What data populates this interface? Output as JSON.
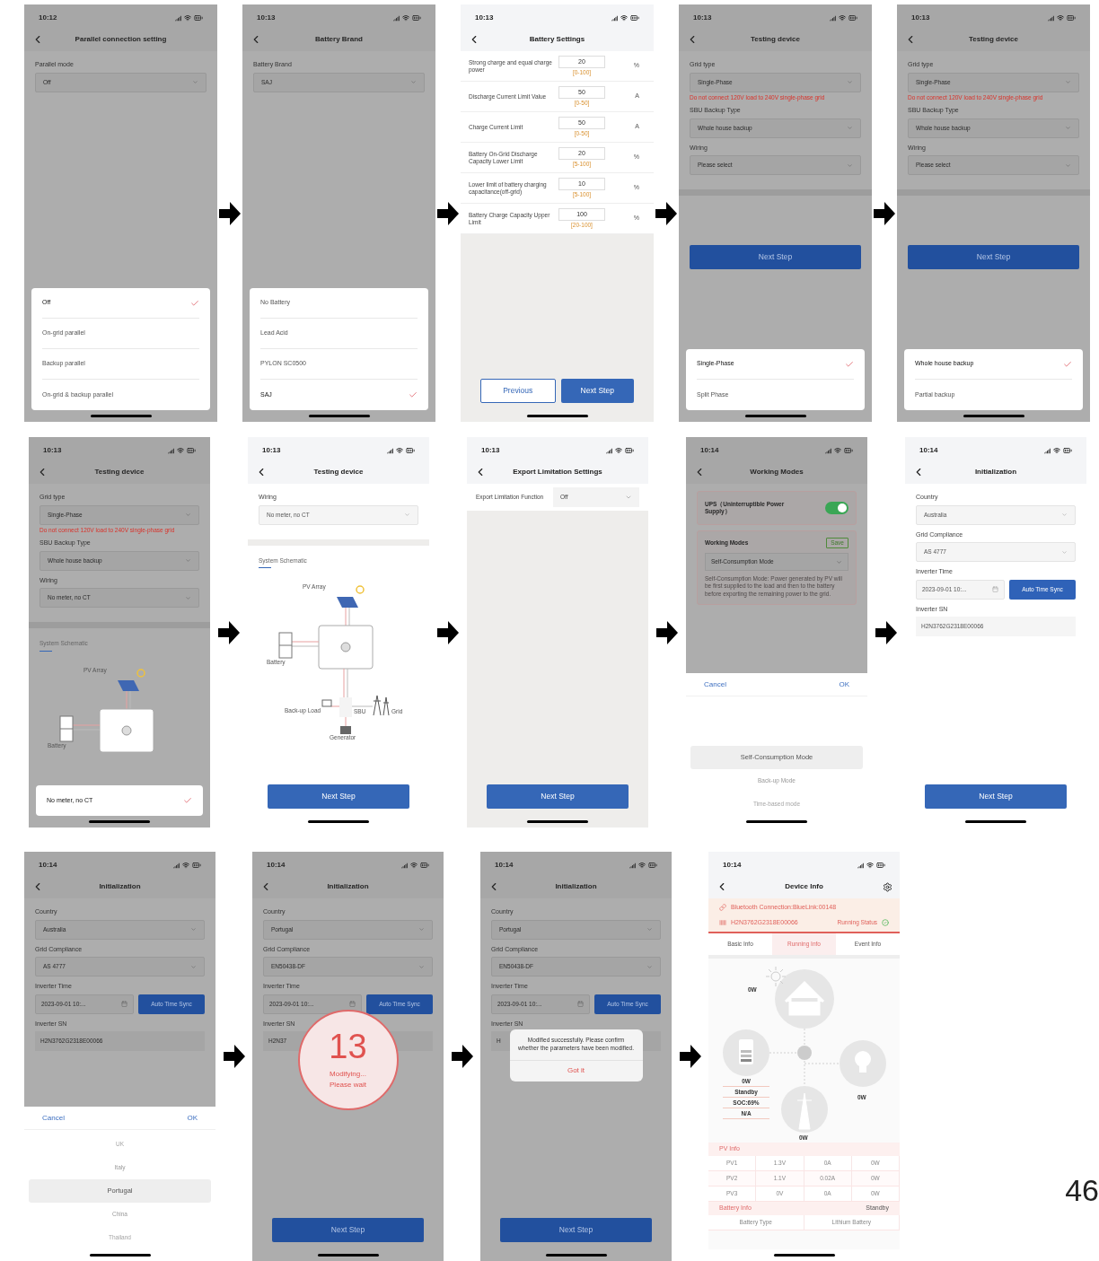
{
  "rows": [
    {
      "screens": [
        {
          "time": "10:12",
          "title": "Parallel connection setting",
          "dimmed": true,
          "body": [
            {
              "kind": "label",
              "text": "Parallel mode"
            },
            {
              "kind": "select",
              "value": "Off"
            }
          ],
          "sheet": {
            "kind": "options",
            "options": [
              {
                "label": "Off",
                "selected": true
              },
              {
                "label": "On-grid parallel",
                "selected": false
              },
              {
                "label": "Backup parallel",
                "selected": false
              },
              {
                "label": "On-grid & backup parallel",
                "selected": false
              }
            ]
          }
        },
        {
          "time": "10:13",
          "title": "Battery Brand",
          "dimmed": true,
          "body": [
            {
              "kind": "label",
              "text": "Battery Brand"
            },
            {
              "kind": "select",
              "value": "SAJ"
            }
          ],
          "sheet": {
            "kind": "options",
            "options": [
              {
                "label": "No Battery",
                "selected": false
              },
              {
                "label": "Lead Acid",
                "selected": false
              },
              {
                "label": "PYLON SC0500",
                "selected": false
              },
              {
                "label": "SAJ",
                "selected": true
              }
            ]
          }
        },
        {
          "time": "10:13",
          "title": "Battery Settings",
          "dimmed": false,
          "body": [
            {
              "kind": "param",
              "label": "Strong charge and equal charge power",
              "value": "20",
              "range": "[0-100]",
              "unit": "%"
            },
            {
              "kind": "param",
              "label": "Discharge Current Limit Value",
              "value": "50",
              "range": "[0-50]",
              "unit": "A"
            },
            {
              "kind": "param",
              "label": "Charge Current Limit",
              "value": "50",
              "range": "[0-50]",
              "unit": "A"
            },
            {
              "kind": "param",
              "label": "Battery On-Grid Discharge Capacity Lower Limit",
              "value": "20",
              "range": "[5-100]",
              "unit": "%"
            },
            {
              "kind": "param",
              "label": "Lower limit of battery charging capacitance(off-grid)",
              "value": "10",
              "range": "[5-100]",
              "unit": "%"
            },
            {
              "kind": "param",
              "label": "Battery Charge Capacity Upper Limit",
              "value": "100",
              "range": "[20-100]",
              "unit": "%"
            }
          ],
          "footer": [
            {
              "label": "Previous",
              "kind": "outline"
            },
            {
              "label": "Next Step",
              "kind": "primary"
            }
          ]
        },
        {
          "time": "10:13",
          "title": "Testing device",
          "dimmed": true,
          "body": [
            {
              "kind": "label",
              "text": "Grid type"
            },
            {
              "kind": "select",
              "value": "Single-Phase"
            },
            {
              "kind": "warning",
              "text": "Do not connect 120V load to 240V single-phase grid"
            },
            {
              "kind": "label",
              "text": "SBU Backup Type"
            },
            {
              "kind": "select",
              "value": "Whole house backup"
            },
            {
              "kind": "label",
              "text": "Wiring"
            },
            {
              "kind": "select",
              "value": "Please select"
            },
            {
              "kind": "divider"
            },
            {
              "kind": "button",
              "label": "Next Step"
            }
          ],
          "sheet": {
            "kind": "options",
            "options": [
              {
                "label": "Single-Phase",
                "selected": true
              },
              {
                "label": "Split Phase",
                "selected": false
              }
            ]
          }
        },
        {
          "time": "10:13",
          "title": "Testing device",
          "dimmed": true,
          "body": [
            {
              "kind": "label",
              "text": "Grid type"
            },
            {
              "kind": "select",
              "value": "Single-Phase"
            },
            {
              "kind": "warning",
              "text": "Do not connect 120V load to 240V single-phase grid"
            },
            {
              "kind": "label",
              "text": "SBU Backup Type"
            },
            {
              "kind": "select",
              "value": "Whole house backup"
            },
            {
              "kind": "label",
              "text": "Wiring"
            },
            {
              "kind": "select",
              "value": "Please select"
            },
            {
              "kind": "divider"
            },
            {
              "kind": "button",
              "label": "Next Step"
            }
          ],
          "sheet": {
            "kind": "options",
            "options": [
              {
                "label": "Whole house backup",
                "selected": true
              },
              {
                "label": "Partial backup",
                "selected": false
              }
            ]
          }
        }
      ]
    },
    {
      "screens": [
        {
          "time": "10:13",
          "title": "Testing device",
          "dimmed": true,
          "body": [
            {
              "kind": "label",
              "text": "Grid type"
            },
            {
              "kind": "select",
              "value": "Single-Phase"
            },
            {
              "kind": "warning",
              "text": "Do not connect 120V load to 240V single-phase grid"
            },
            {
              "kind": "label",
              "text": "SBU Backup Type"
            },
            {
              "kind": "select",
              "value": "Whole house backup"
            },
            {
              "kind": "label",
              "text": "Wiring"
            },
            {
              "kind": "select",
              "value": "No meter, no CT"
            },
            {
              "kind": "divider"
            },
            {
              "kind": "section",
              "text": "System Schematic"
            },
            {
              "kind": "schematic",
              "parts": [
                {
                  "kind": "pv",
                  "label": "PV Array"
                },
                {
                  "kind": "inverter"
                },
                {
                  "kind": "battery",
                  "label": "Battery"
                }
              ]
            }
          ],
          "sheet": {
            "kind": "options",
            "options": [
              {
                "label": "No meter, no CT",
                "selected": true
              }
            ]
          }
        },
        {
          "time": "10:13",
          "title": "Testing device",
          "dimmed": false,
          "body": [
            {
              "kind": "label",
              "text": "Wiring"
            },
            {
              "kind": "select",
              "value": "No meter, no CT"
            },
            {
              "kind": "divider"
            },
            {
              "kind": "section",
              "text": "System Schematic"
            },
            {
              "kind": "schematic",
              "parts": [
                {
                  "kind": "pv",
                  "label": "PV Array"
                },
                {
                  "kind": "inverter"
                },
                {
                  "kind": "battery",
                  "label": "Battery"
                },
                {
                  "kind": "load",
                  "label": "Back-up Load"
                },
                {
                  "kind": "sbu",
                  "label": "SBU"
                },
                {
                  "kind": "grid",
                  "label": "Grid"
                },
                {
                  "kind": "generator",
                  "label": "Generator"
                }
              ]
            }
          ],
          "footer": [
            {
              "label": "Next Step",
              "kind": "primary"
            }
          ]
        },
        {
          "time": "10:13",
          "title": "Export Limitation Settings",
          "dimmed": false,
          "body": [
            {
              "kind": "inline_select",
              "label": "Export Limitation Function",
              "value": "Off"
            }
          ],
          "footer": [
            {
              "label": "Next Step",
              "kind": "primary"
            }
          ]
        },
        {
          "time": "10:14",
          "title": "Working Modes",
          "dimmed": true,
          "body": [
            {
              "kind": "toggle_card",
              "label": "UPS（Uninterruptible Power Supply）",
              "on": true
            },
            {
              "kind": "mode_card",
              "title": "Working Modes",
              "action": "Save",
              "value": "Self-Consumption Mode",
              "description": "Self-Consumption Mode: Power generated by PV will be first supplied to the load and then to the battery before exporting the remaining power to the grid."
            }
          ],
          "sheet": {
            "kind": "picker",
            "cancel": "Cancel",
            "ok": "OK",
            "options": [
              {
                "label": "Self-Consumption Mode",
                "selected": true
              },
              {
                "label": "Back-up Mode",
                "selected": false
              },
              {
                "label": "Time-based mode",
                "selected": false
              }
            ]
          }
        },
        {
          "time": "10:14",
          "title": "Initialization",
          "dimmed": false,
          "body": [
            {
              "kind": "label",
              "text": "Country"
            },
            {
              "kind": "select",
              "value": "Australia"
            },
            {
              "kind": "label",
              "text": "Grid Compliance"
            },
            {
              "kind": "select",
              "value": "AS 4777"
            },
            {
              "kind": "label",
              "text": "Inverter Time"
            },
            {
              "kind": "time",
              "value": "2023-09-01 10:...",
              "button": "Auto Time Sync"
            },
            {
              "kind": "label",
              "text": "Inverter SN"
            },
            {
              "kind": "field",
              "value": "H2N3762G2318E00066"
            }
          ],
          "footer": [
            {
              "label": "Next Step",
              "kind": "primary"
            }
          ]
        }
      ]
    },
    {
      "screens": [
        {
          "time": "10:14",
          "title": "Initialization",
          "dimmed": true,
          "body": [
            {
              "kind": "label",
              "text": "Country"
            },
            {
              "kind": "select",
              "value": "Australia"
            },
            {
              "kind": "label",
              "text": "Grid Compliance"
            },
            {
              "kind": "select",
              "value": "AS 4777"
            },
            {
              "kind": "label",
              "text": "Inverter Time"
            },
            {
              "kind": "time",
              "value": "2023-09-01 10:...",
              "button": "Auto Time Sync"
            },
            {
              "kind": "label",
              "text": "Inverter SN"
            },
            {
              "kind": "field",
              "value": "H2N3762G2318E00066"
            }
          ],
          "sheet": {
            "kind": "picker",
            "cancel": "Cancel",
            "ok": "OK",
            "options": [
              {
                "label": "UK",
                "selected": false
              },
              {
                "label": "Italy",
                "selected": false
              },
              {
                "label": "Portugal",
                "selected": true
              },
              {
                "label": "China",
                "selected": false
              },
              {
                "label": "Thailand",
                "selected": false
              }
            ]
          }
        },
        {
          "time": "10:14",
          "title": "Initialization",
          "dimmed": true,
          "body": [
            {
              "kind": "label",
              "text": "Country"
            },
            {
              "kind": "select",
              "value": "Portugal"
            },
            {
              "kind": "label",
              "text": "Grid Compliance"
            },
            {
              "kind": "select",
              "value": "EN50438-DF"
            },
            {
              "kind": "label",
              "text": "Inverter Time"
            },
            {
              "kind": "time",
              "value": "2023-09-01 10:...",
              "button": "Auto Time Sync"
            },
            {
              "kind": "label",
              "text": "Inverter SN"
            },
            {
              "kind": "field",
              "value": "H2N37"
            }
          ],
          "overlay": {
            "kind": "loading",
            "count": "13",
            "lines": [
              "Modifying...",
              "Please wait"
            ]
          },
          "footer": [
            {
              "label": "Next Step",
              "kind": "primary"
            }
          ]
        },
        {
          "time": "10:14",
          "title": "Initialization",
          "dimmed": true,
          "body": [
            {
              "kind": "label",
              "text": "Country"
            },
            {
              "kind": "select",
              "value": "Portugal"
            },
            {
              "kind": "label",
              "text": "Grid Compliance"
            },
            {
              "kind": "select",
              "value": "EN50438-DF"
            },
            {
              "kind": "label",
              "text": "Inverter Time"
            },
            {
              "kind": "time",
              "value": "2023-09-01 10:...",
              "button": "Auto Time Sync"
            },
            {
              "kind": "label",
              "text": "Inverter SN"
            },
            {
              "kind": "field",
              "value": "H"
            }
          ],
          "overlay": {
            "kind": "dialog",
            "message": "Modified successfully. Please confirm whether the parameters have been modified.",
            "button": "Got it"
          },
          "footer": [
            {
              "label": "Next Step",
              "kind": "primary"
            }
          ]
        },
        {
          "time": "10:14",
          "title": "Device Info",
          "dimmed": false,
          "settings_button": true,
          "body": [
            {
              "kind": "banner",
              "link": "Bluetooth Connection:BlueLink:00148",
              "serial": "H2N3762G2318E00066",
              "status": "Running Status",
              "ok": true
            },
            {
              "kind": "tabs",
              "tabs": [
                {
                  "label": "Basic Info",
                  "selected": false
                },
                {
                  "label": "Running Info",
                  "selected": true
                },
                {
                  "label": "Event Info",
                  "selected": false
                }
              ]
            },
            {
              "kind": "flow",
              "pv": "0W",
              "battery": [
                "0W",
                "Standby",
                "SOC:69%",
                "N/A"
              ],
              "load": "0W",
              "grid": "0W"
            },
            {
              "kind": "table_header",
              "title": "PV Info"
            },
            {
              "kind": "table",
              "rows": [
                [
                  "PV1",
                  "1.3V",
                  "0A",
                  "0W"
                ],
                [
                  "PV2",
                  "1.1V",
                  "0.02A",
                  "0W"
                ],
                [
                  "PV3",
                  "0V",
                  "0A",
                  "0W"
                ]
              ]
            },
            {
              "kind": "table_header",
              "title": "Battery Info",
              "value": "Standby"
            },
            {
              "kind": "table",
              "rows": [
                [
                  "Battery Type",
                  "Lithium Battery"
                ]
              ]
            }
          ]
        }
      ]
    }
  ],
  "page_number": "46"
}
